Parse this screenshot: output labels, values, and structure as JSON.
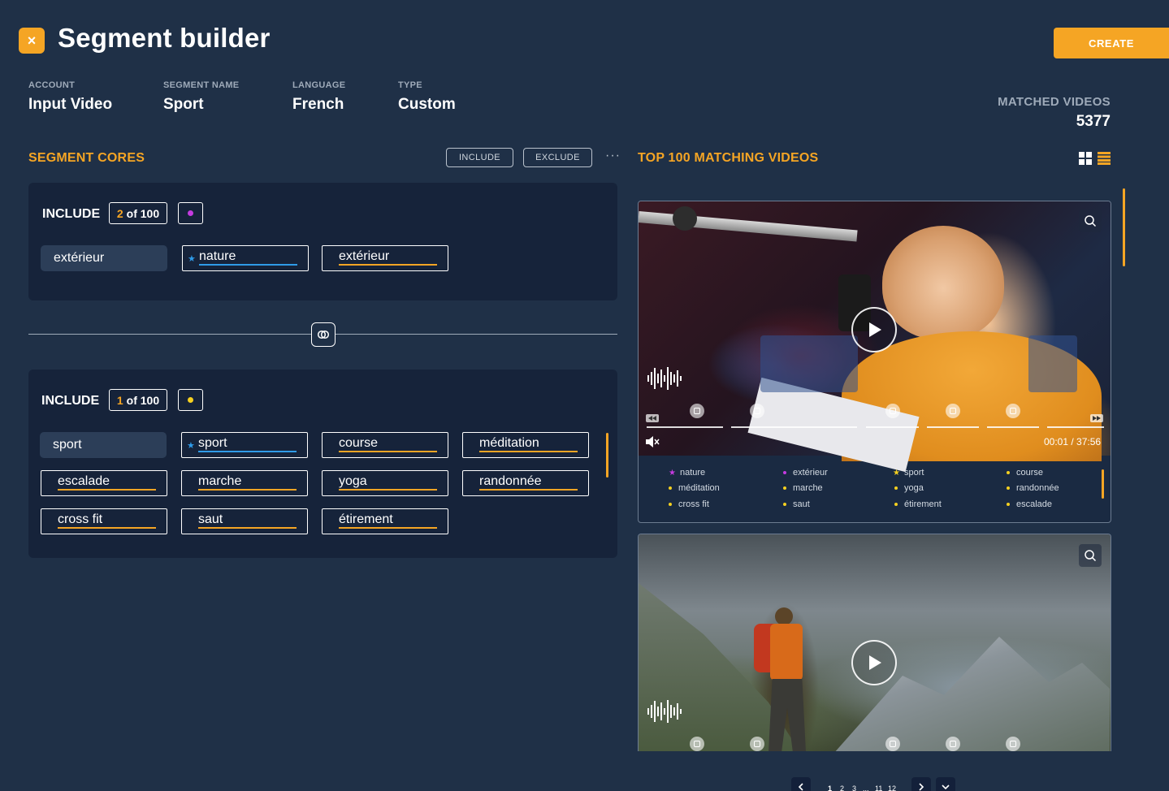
{
  "header": {
    "close_glyph": "×",
    "title": "Segment builder",
    "create_label": "CREATE"
  },
  "meta": [
    {
      "label": "ACCOUNT",
      "value": "Input Video"
    },
    {
      "label": "SEGMENT NAME",
      "value": "Sport"
    },
    {
      "label": "LANGUAGE",
      "value": "French"
    },
    {
      "label": "TYPE",
      "value": "Custom"
    }
  ],
  "matched": {
    "label": "MATCHED VIDEOS",
    "value": "5377"
  },
  "segment_cores": {
    "title": "SEGMENT CORES",
    "include_btn": "INCLUDE",
    "exclude_btn": "EXCLUDE",
    "more": "···"
  },
  "group1": {
    "label": "INCLUDE",
    "count_num": "2",
    "count_rest": "of 100",
    "dot_color": "#c53be0",
    "tags": [
      "extérieur",
      "nature",
      "extérieur"
    ]
  },
  "group2": {
    "label": "INCLUDE",
    "count_num": "1",
    "count_rest": "of 100",
    "dot_color": "#f5d020",
    "tags": [
      "sport",
      "sport",
      "course",
      "méditation",
      "escalade",
      "marche",
      "yoga",
      "randonnée",
      "cross fit",
      "saut",
      "étirement"
    ]
  },
  "top_videos": {
    "title": "TOP 100 MATCHING VIDEOS"
  },
  "video1": {
    "time": "00:01 / 37:56",
    "keywords": [
      {
        "text": "nature",
        "marker": "star",
        "color": "#c53be0"
      },
      {
        "text": "extérieur",
        "marker": "dot",
        "color": "#c53be0"
      },
      {
        "text": "sport",
        "marker": "star",
        "color": "#f5d020"
      },
      {
        "text": "course",
        "marker": "dot",
        "color": "#f5d020"
      },
      {
        "text": "méditation",
        "marker": "dot",
        "color": "#f5d020"
      },
      {
        "text": "marche",
        "marker": "dot",
        "color": "#f5d020"
      },
      {
        "text": "yoga",
        "marker": "dot",
        "color": "#f5d020"
      },
      {
        "text": "randonnée",
        "marker": "dot",
        "color": "#f5d020"
      },
      {
        "text": "cross fit",
        "marker": "dot",
        "color": "#f5d020"
      },
      {
        "text": "saut",
        "marker": "dot",
        "color": "#f5d020"
      },
      {
        "text": "étirement",
        "marker": "dot",
        "color": "#f5d020"
      },
      {
        "text": "escalade",
        "marker": "dot",
        "color": "#f5d020"
      }
    ]
  },
  "pagination": {
    "p1": "1",
    "p2": "2",
    "p3": "3",
    "ellipsis": "...",
    "p11": "11",
    "p12": "12"
  },
  "colors": {
    "accent": "#f5a524",
    "background": "#1f3047",
    "card": "#16233a",
    "blue": "#2f9be8"
  }
}
